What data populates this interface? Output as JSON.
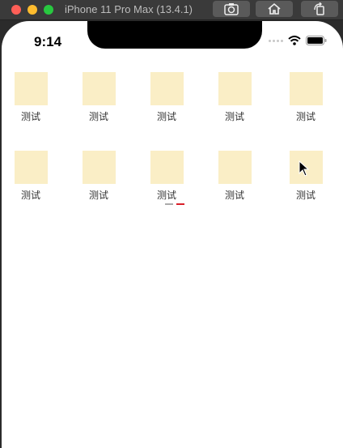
{
  "window": {
    "title": "iPhone 11 Pro Max (13.4.1)"
  },
  "status_bar": {
    "time": "9:14"
  },
  "grid": {
    "items": [
      {
        "label": "测试"
      },
      {
        "label": "测试"
      },
      {
        "label": "测试"
      },
      {
        "label": "测试"
      },
      {
        "label": "测试"
      },
      {
        "label": "测试"
      },
      {
        "label": "测试"
      },
      {
        "label": "测试"
      },
      {
        "label": "测试"
      },
      {
        "label": "测试"
      }
    ]
  },
  "colors": {
    "tile": "#faeec6",
    "indicator_active": "#d9202a",
    "indicator_inactive": "#aaaaaa"
  }
}
